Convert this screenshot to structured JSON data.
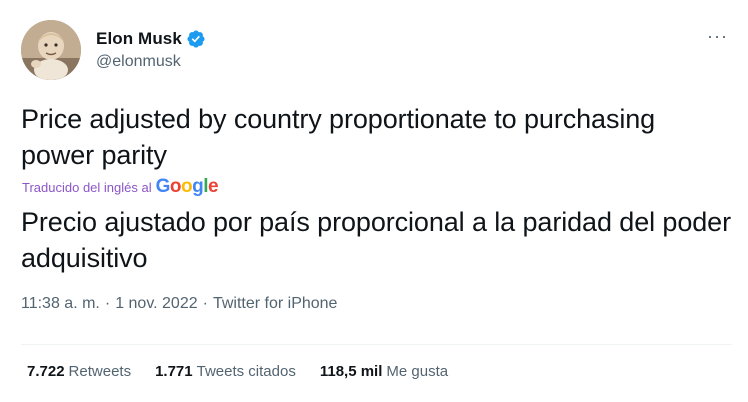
{
  "author": {
    "display_name": "Elon Musk",
    "handle": "@elonmusk",
    "avatar_icon": "avatar-photo",
    "verified_icon": "verified-badge-icon",
    "verified_color": "#1d9bf0"
  },
  "more_button": "···",
  "tweet": {
    "original_text": "Price adjusted by country proportionate to purchasing power parity",
    "translated_label": "Traducido del inglés al",
    "translator_logo": [
      "G",
      "o",
      "o",
      "g",
      "l",
      "e"
    ],
    "translated_text": "Precio ajustado por país proporcional a la paridad del poder adquisitivo"
  },
  "meta": {
    "time": "11:38 a. m.",
    "separator": "·",
    "date": "1 nov. 2022",
    "source": "Twitter for iPhone"
  },
  "stats": {
    "retweets": {
      "value": "7.722",
      "label": "Retweets"
    },
    "quotes": {
      "value": "1.771",
      "label": "Tweets citados"
    },
    "likes": {
      "value": "118,5 mil",
      "label": "Me gusta"
    }
  },
  "colors": {
    "text": "#0f1419",
    "secondary": "#536471",
    "translated_label": "#8b57c8",
    "divider": "#eff3f4"
  }
}
